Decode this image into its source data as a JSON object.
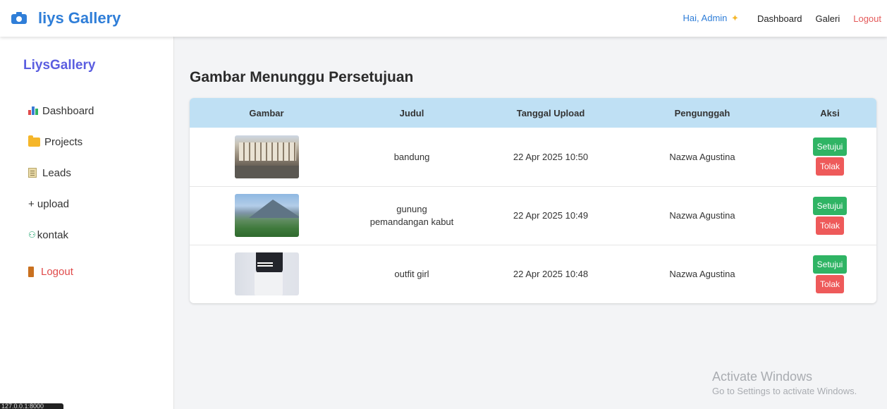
{
  "header": {
    "brand": "liys Gallery",
    "greeting": "Hai, Admin",
    "nav": {
      "dashboard": "Dashboard",
      "galeri": "Galeri",
      "logout": "Logout"
    }
  },
  "sidebar": {
    "title": "LiysGallery",
    "items": [
      {
        "label": "Dashboard",
        "icon": "chart-icon"
      },
      {
        "label": "Projects",
        "icon": "folder-icon"
      },
      {
        "label": "Leads",
        "icon": "note-icon"
      },
      {
        "label": "+ upload",
        "icon": ""
      },
      {
        "label": "kontak",
        "icon": "user-icon"
      },
      {
        "label": "Logout",
        "icon": "door-icon"
      }
    ]
  },
  "main": {
    "title": "Gambar Menunggu Persetujuan",
    "table": {
      "columns": [
        "Gambar",
        "Judul",
        "Tanggal Upload",
        "Pengunggah",
        "Aksi"
      ],
      "rows": [
        {
          "judul": "bandung",
          "tanggal": "22 Apr 2025 10:50",
          "pengunggah": "Nazwa Agustina",
          "approve": "Setujui",
          "reject": "Tolak"
        },
        {
          "judul": "gunung pemandangan kabut",
          "tanggal": "22 Apr 2025 10:49",
          "pengunggah": "Nazwa Agustina",
          "approve": "Setujui",
          "reject": "Tolak"
        },
        {
          "judul": "outfit girl",
          "tanggal": "22 Apr 2025 10:48",
          "pengunggah": "Nazwa Agustina",
          "approve": "Setujui",
          "reject": "Tolak"
        }
      ]
    }
  },
  "watermark": {
    "line1": "Activate Windows",
    "line2": "Go to Settings to activate Windows."
  },
  "status_url": "127.0.0.1:8000",
  "colors": {
    "brand": "#2f7ed8",
    "sidebar_title": "#5b5ee0",
    "approve": "#2fb464",
    "reject": "#ee5a5a",
    "table_header": "#bfe0f4"
  }
}
